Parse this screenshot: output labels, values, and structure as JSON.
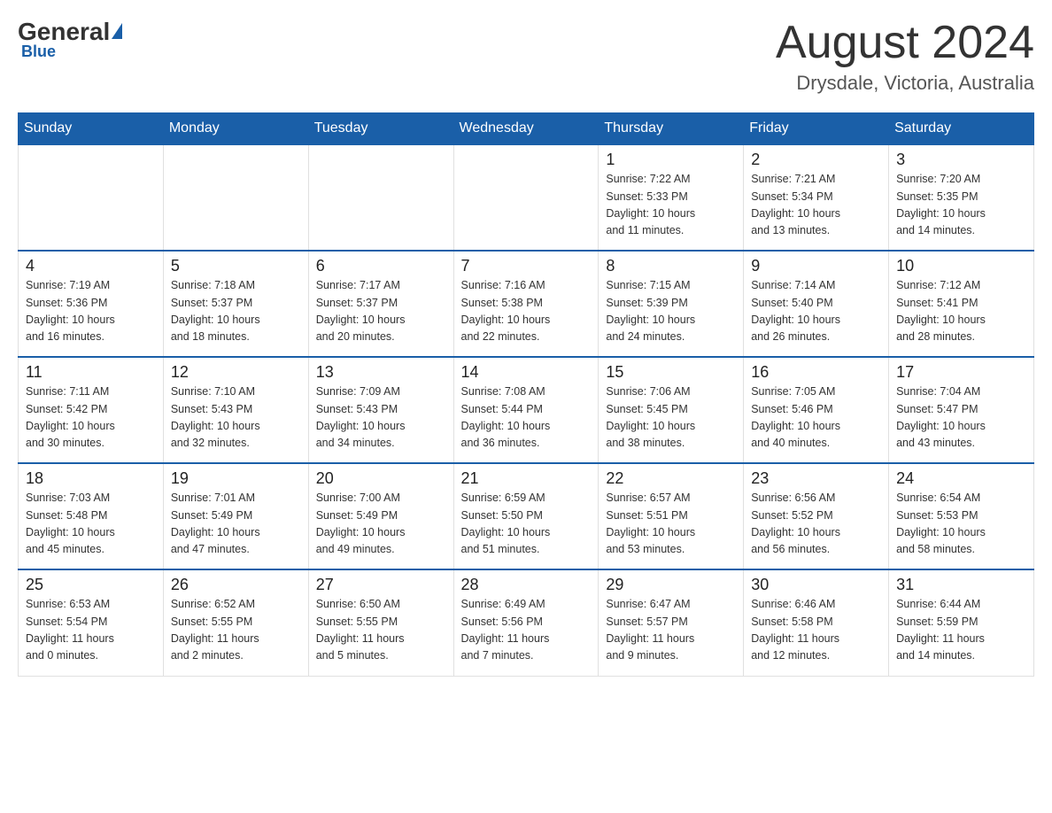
{
  "header": {
    "logo_general": "General",
    "logo_blue": "Blue",
    "month_title": "August 2024",
    "location": "Drysdale, Victoria, Australia"
  },
  "weekdays": [
    "Sunday",
    "Monday",
    "Tuesday",
    "Wednesday",
    "Thursday",
    "Friday",
    "Saturday"
  ],
  "weeks": [
    [
      {
        "day": "",
        "info": ""
      },
      {
        "day": "",
        "info": ""
      },
      {
        "day": "",
        "info": ""
      },
      {
        "day": "",
        "info": ""
      },
      {
        "day": "1",
        "info": "Sunrise: 7:22 AM\nSunset: 5:33 PM\nDaylight: 10 hours\nand 11 minutes."
      },
      {
        "day": "2",
        "info": "Sunrise: 7:21 AM\nSunset: 5:34 PM\nDaylight: 10 hours\nand 13 minutes."
      },
      {
        "day": "3",
        "info": "Sunrise: 7:20 AM\nSunset: 5:35 PM\nDaylight: 10 hours\nand 14 minutes."
      }
    ],
    [
      {
        "day": "4",
        "info": "Sunrise: 7:19 AM\nSunset: 5:36 PM\nDaylight: 10 hours\nand 16 minutes."
      },
      {
        "day": "5",
        "info": "Sunrise: 7:18 AM\nSunset: 5:37 PM\nDaylight: 10 hours\nand 18 minutes."
      },
      {
        "day": "6",
        "info": "Sunrise: 7:17 AM\nSunset: 5:37 PM\nDaylight: 10 hours\nand 20 minutes."
      },
      {
        "day": "7",
        "info": "Sunrise: 7:16 AM\nSunset: 5:38 PM\nDaylight: 10 hours\nand 22 minutes."
      },
      {
        "day": "8",
        "info": "Sunrise: 7:15 AM\nSunset: 5:39 PM\nDaylight: 10 hours\nand 24 minutes."
      },
      {
        "day": "9",
        "info": "Sunrise: 7:14 AM\nSunset: 5:40 PM\nDaylight: 10 hours\nand 26 minutes."
      },
      {
        "day": "10",
        "info": "Sunrise: 7:12 AM\nSunset: 5:41 PM\nDaylight: 10 hours\nand 28 minutes."
      }
    ],
    [
      {
        "day": "11",
        "info": "Sunrise: 7:11 AM\nSunset: 5:42 PM\nDaylight: 10 hours\nand 30 minutes."
      },
      {
        "day": "12",
        "info": "Sunrise: 7:10 AM\nSunset: 5:43 PM\nDaylight: 10 hours\nand 32 minutes."
      },
      {
        "day": "13",
        "info": "Sunrise: 7:09 AM\nSunset: 5:43 PM\nDaylight: 10 hours\nand 34 minutes."
      },
      {
        "day": "14",
        "info": "Sunrise: 7:08 AM\nSunset: 5:44 PM\nDaylight: 10 hours\nand 36 minutes."
      },
      {
        "day": "15",
        "info": "Sunrise: 7:06 AM\nSunset: 5:45 PM\nDaylight: 10 hours\nand 38 minutes."
      },
      {
        "day": "16",
        "info": "Sunrise: 7:05 AM\nSunset: 5:46 PM\nDaylight: 10 hours\nand 40 minutes."
      },
      {
        "day": "17",
        "info": "Sunrise: 7:04 AM\nSunset: 5:47 PM\nDaylight: 10 hours\nand 43 minutes."
      }
    ],
    [
      {
        "day": "18",
        "info": "Sunrise: 7:03 AM\nSunset: 5:48 PM\nDaylight: 10 hours\nand 45 minutes."
      },
      {
        "day": "19",
        "info": "Sunrise: 7:01 AM\nSunset: 5:49 PM\nDaylight: 10 hours\nand 47 minutes."
      },
      {
        "day": "20",
        "info": "Sunrise: 7:00 AM\nSunset: 5:49 PM\nDaylight: 10 hours\nand 49 minutes."
      },
      {
        "day": "21",
        "info": "Sunrise: 6:59 AM\nSunset: 5:50 PM\nDaylight: 10 hours\nand 51 minutes."
      },
      {
        "day": "22",
        "info": "Sunrise: 6:57 AM\nSunset: 5:51 PM\nDaylight: 10 hours\nand 53 minutes."
      },
      {
        "day": "23",
        "info": "Sunrise: 6:56 AM\nSunset: 5:52 PM\nDaylight: 10 hours\nand 56 minutes."
      },
      {
        "day": "24",
        "info": "Sunrise: 6:54 AM\nSunset: 5:53 PM\nDaylight: 10 hours\nand 58 minutes."
      }
    ],
    [
      {
        "day": "25",
        "info": "Sunrise: 6:53 AM\nSunset: 5:54 PM\nDaylight: 11 hours\nand 0 minutes."
      },
      {
        "day": "26",
        "info": "Sunrise: 6:52 AM\nSunset: 5:55 PM\nDaylight: 11 hours\nand 2 minutes."
      },
      {
        "day": "27",
        "info": "Sunrise: 6:50 AM\nSunset: 5:55 PM\nDaylight: 11 hours\nand 5 minutes."
      },
      {
        "day": "28",
        "info": "Sunrise: 6:49 AM\nSunset: 5:56 PM\nDaylight: 11 hours\nand 7 minutes."
      },
      {
        "day": "29",
        "info": "Sunrise: 6:47 AM\nSunset: 5:57 PM\nDaylight: 11 hours\nand 9 minutes."
      },
      {
        "day": "30",
        "info": "Sunrise: 6:46 AM\nSunset: 5:58 PM\nDaylight: 11 hours\nand 12 minutes."
      },
      {
        "day": "31",
        "info": "Sunrise: 6:44 AM\nSunset: 5:59 PM\nDaylight: 11 hours\nand 14 minutes."
      }
    ]
  ]
}
